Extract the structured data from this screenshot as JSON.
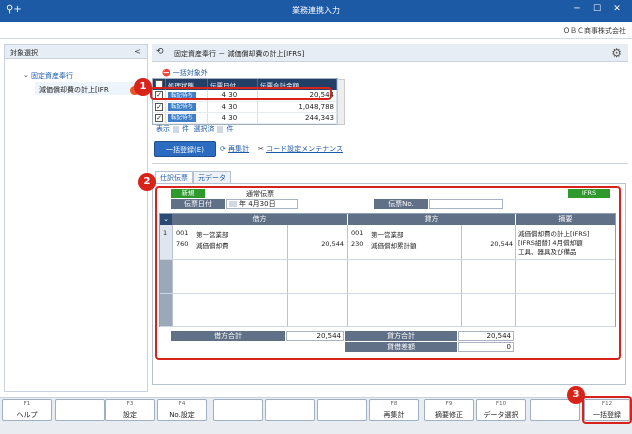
{
  "window": {
    "title": "業務連携入力",
    "min_glyph": "─",
    "max_glyph": "☐",
    "close_glyph": "✕"
  },
  "company": "ＯＢＣ商事株式会社",
  "left_pane": {
    "title": "対象選択",
    "collapse_glyph": "<",
    "tree": [
      {
        "label": "固定資産奉行"
      },
      {
        "label": "減価償却費の計上[IFR"
      }
    ]
  },
  "right_header": {
    "breadcrumb": "固定資産奉行 － 減価償却費の計上[IFRS]"
  },
  "exclude_link": "一括対象外",
  "small_grid": {
    "columns": [
      "処理状態",
      "伝票日付",
      "伝票合計金額"
    ],
    "rows": [
      {
        "status": "転記待ち",
        "month": "4",
        "day": "30",
        "amount": "20,544"
      },
      {
        "status": "転記待ち",
        "month": "4",
        "day": "30",
        "amount": "1,048,788"
      },
      {
        "status": "転記待ち",
        "month": "4",
        "day": "30",
        "amount": "244,343"
      }
    ]
  },
  "counts": {
    "display_label": "表示",
    "selected_label": "選択済",
    "unit": "件"
  },
  "actions": {
    "batch_register": "一括登録(E)",
    "recalc": "再集計",
    "code_settings": "コード設定メンテナンス"
  },
  "tabs": [
    "仕訳伝票",
    "元データ"
  ],
  "voucher": {
    "badge": "新規",
    "type": "通常伝票",
    "ifrs": "IFRS",
    "date_label": "伝票日付",
    "date_value": "年  4月30日",
    "voucher_no_label": "伝票No.",
    "voucher_no_value": ""
  },
  "journal": {
    "headers": {
      "debit": "借方",
      "credit": "貸方",
      "memo": "摘要"
    },
    "row_number": "1",
    "debit": {
      "dept_code": "001",
      "dept_name": "第一営業部",
      "account_code": "760",
      "account_name": "減価償却費",
      "amount": "20,544"
    },
    "credit": {
      "dept_code": "001",
      "dept_name": "第一営業部",
      "account_code": "230",
      "account_name": "減価償却累計額",
      "amount": "20,544"
    },
    "memo_lines": [
      "減価償却費の計上[IFRS]",
      "[IFRS組替] 4月償却額",
      "工具、器具及び備品"
    ]
  },
  "totals": {
    "debit_total_label": "借方合計",
    "debit_total": "20,544",
    "credit_total_label": "貸方合計",
    "credit_total": "20,544",
    "diff_label": "貸借差額",
    "diff": "0"
  },
  "callouts": [
    "1",
    "2",
    "3"
  ],
  "fkeys": [
    {
      "num": "F1",
      "label": "ヘルプ"
    },
    {
      "num": "",
      "label": ""
    },
    {
      "num": "F3",
      "label": "設定"
    },
    {
      "num": "F4",
      "label": "No.設定"
    },
    {
      "num": "",
      "label": ""
    },
    {
      "num": "",
      "label": ""
    },
    {
      "num": "",
      "label": ""
    },
    {
      "num": "F8",
      "label": "再集計"
    },
    {
      "num": "F9",
      "label": "摘要修正"
    },
    {
      "num": "F10",
      "label": "データ選択"
    },
    {
      "num": "",
      "label": ""
    },
    {
      "num": "F12",
      "label": "一括登録"
    }
  ]
}
